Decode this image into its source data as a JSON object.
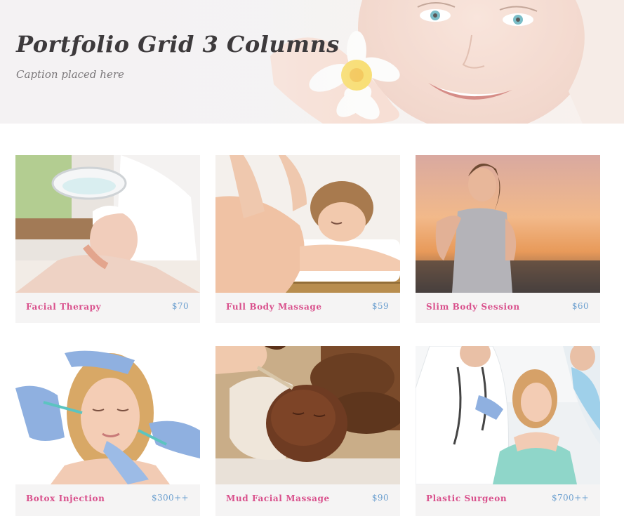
{
  "hero": {
    "title": "Portfolio Grid 3 Columns",
    "caption": "Caption placed here"
  },
  "colors": {
    "item_name": "#d9508c",
    "price": "#6b9fcf",
    "card_footer_bg": "#f5f4f4",
    "title": "#3d3a3c"
  },
  "items": [
    {
      "name": "Facial Therapy",
      "price": "$70",
      "image": "facial-therapy-photo"
    },
    {
      "name": "Full Body Massage",
      "price": "$59",
      "image": "body-massage-photo"
    },
    {
      "name": "Slim Body Session",
      "price": "$60",
      "image": "slim-body-photo"
    },
    {
      "name": "Botox Injection",
      "price": "$300++",
      "image": "botox-injection-photo"
    },
    {
      "name": "Mud Facial Massage",
      "price": "$90",
      "image": "mud-facial-photo"
    },
    {
      "name": "Plastic Surgeon",
      "price": "$700++",
      "image": "plastic-surgeon-photo"
    }
  ]
}
